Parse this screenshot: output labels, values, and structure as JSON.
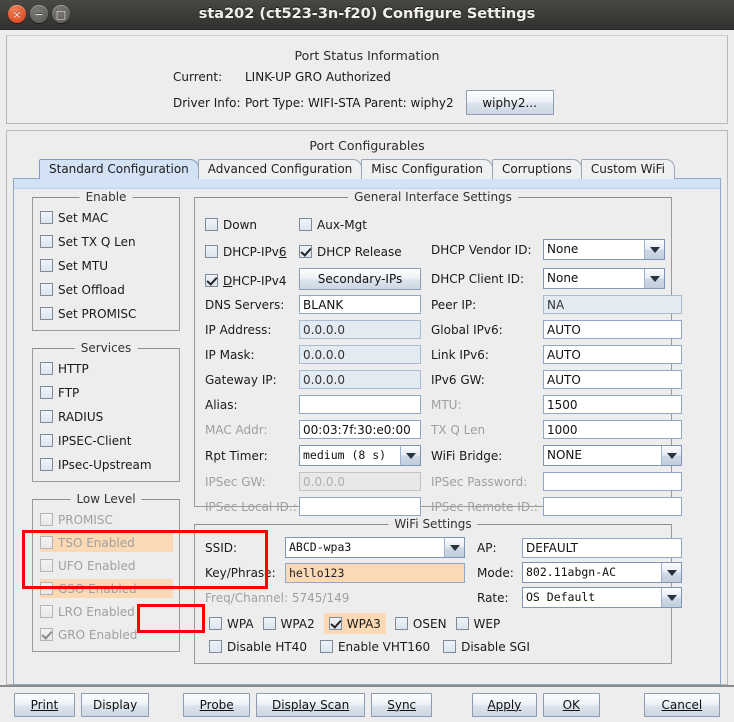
{
  "window": {
    "title": "sta202  (ct523-3n-f20) Configure Settings",
    "controls": [
      {
        "name": "close",
        "glyph": "×"
      },
      {
        "name": "minimize",
        "glyph": "−"
      },
      {
        "name": "maximize",
        "glyph": "□"
      }
    ]
  },
  "port_status": {
    "title": "Port Status Information",
    "current_label": "Current:",
    "current_value": "LINK-UP GRO  Authorized",
    "driver_label": "Driver Info:",
    "driver_value": "Port Type: WIFI-STA   Parent: wiphy2",
    "wiphy_button": "wiphy2..."
  },
  "configurables": {
    "title": "Port Configurables",
    "tabs": [
      {
        "label": "Standard Configuration",
        "active": true
      },
      {
        "label": "Advanced Configuration",
        "active": false
      },
      {
        "label": "Misc Configuration",
        "active": false
      },
      {
        "label": "Corruptions",
        "active": false
      },
      {
        "label": "Custom WiFi",
        "active": false
      }
    ]
  },
  "enable_group": {
    "legend": "Enable",
    "items": [
      {
        "label": "Set MAC",
        "checked": false
      },
      {
        "label": "Set TX Q Len",
        "checked": false
      },
      {
        "label": "Set MTU",
        "checked": false
      },
      {
        "label": "Set Offload",
        "checked": false
      },
      {
        "label": "Set PROMISC",
        "checked": false
      }
    ]
  },
  "services_group": {
    "legend": "Services",
    "items": [
      {
        "label": "HTTP",
        "checked": false
      },
      {
        "label": "FTP",
        "checked": false
      },
      {
        "label": "RADIUS",
        "checked": false
      },
      {
        "label": "IPSEC-Client",
        "checked": false
      },
      {
        "label": "IPsec-Upstream",
        "checked": false
      }
    ]
  },
  "lowlevel_group": {
    "legend": "Low Level",
    "items": [
      {
        "label": "PROMISC",
        "checked": false,
        "highlight": false
      },
      {
        "label": "TSO Enabled",
        "checked": false,
        "highlight": true
      },
      {
        "label": "UFO Enabled",
        "checked": false,
        "highlight": false
      },
      {
        "label": "GSO Enabled",
        "checked": false,
        "highlight": true
      },
      {
        "label": "LRO Enabled",
        "checked": false,
        "highlight": false
      },
      {
        "label": "GRO Enabled",
        "checked": true,
        "highlight": false
      }
    ]
  },
  "general": {
    "legend": "General Interface Settings",
    "down_label": "Down",
    "aux_mgt_label": "Aux-Mgt",
    "dhcp_ipv6_label": "DHCP-IPv6",
    "dhcp_release_label": "DHCP Release",
    "dhcp_ipv4_label": "DHCP-IPv4",
    "secondary_ips_button": "Secondary-IPs",
    "dhcp_vendor_label": "DHCP Vendor ID:",
    "dhcp_vendor_value": "None",
    "dhcp_client_label": "DHCP Client ID:",
    "dhcp_client_value": "None",
    "dns_label": "DNS Servers:",
    "dns_value": "BLANK",
    "peer_ip_label": "Peer IP:",
    "peer_ip_value": "NA",
    "ip_address_label": "IP Address:",
    "ip_address_value": "0.0.0.0",
    "global_ipv6_label": "Global IPv6:",
    "global_ipv6_value": "AUTO",
    "ip_mask_label": "IP Mask:",
    "ip_mask_value": "0.0.0.0",
    "link_ipv6_label": "Link IPv6:",
    "link_ipv6_value": "AUTO",
    "gateway_label": "Gateway IP:",
    "gateway_value": "0.0.0.0",
    "ipv6_gw_label": "IPv6 GW:",
    "ipv6_gw_value": "AUTO",
    "alias_label": "Alias:",
    "alias_value": "",
    "mtu_label": "MTU:",
    "mtu_value": "1500",
    "mac_addr_label": "MAC Addr:",
    "mac_addr_value": "00:03:7f:30:e0:00",
    "tx_q_len_label": "TX Q Len",
    "tx_q_len_value": "1000",
    "rpt_timer_label": "Rpt Timer:",
    "rpt_timer_value": "medium  (8 s)",
    "wifi_bridge_label": "WiFi Bridge:",
    "wifi_bridge_value": "NONE",
    "ipsec_gw_label": "IPSec GW:",
    "ipsec_gw_value": "0.0.0.0",
    "ipsec_password_label": "IPSec Password:",
    "ipsec_password_value": "",
    "ipsec_local_id_label": "IPSec Local ID.:",
    "ipsec_local_id_value": "",
    "ipsec_remote_id_label": "IPSec Remote ID.:",
    "ipsec_remote_id_value": "",
    "checks": {
      "down": false,
      "aux_mgt": false,
      "dhcp_ipv6": false,
      "dhcp_release": true,
      "dhcp_ipv4": true
    }
  },
  "wifi": {
    "legend": "WiFi Settings",
    "ssid_label": "SSID:",
    "ssid_value": "ABCD-wpa3",
    "ap_label": "AP:",
    "ap_value": "DEFAULT",
    "key_label": "Key/Phrase:",
    "key_value": "hello123",
    "mode_label": "Mode:",
    "mode_value": "802.11abgn-AC",
    "freq_channel_label": "Freq/Channel: 5745/149",
    "rate_label": "Rate:",
    "rate_value": "OS Default",
    "security": [
      {
        "label": "WPA",
        "checked": false,
        "highlight": false
      },
      {
        "label": "WPA2",
        "checked": false,
        "highlight": false
      },
      {
        "label": "WPA3",
        "checked": true,
        "highlight": true
      },
      {
        "label": "OSEN",
        "checked": false,
        "highlight": false
      },
      {
        "label": "WEP",
        "checked": false,
        "highlight": false
      }
    ],
    "options": [
      {
        "label": "Disable HT40",
        "checked": false
      },
      {
        "label": "Enable VHT160",
        "checked": false
      },
      {
        "label": "Disable SGI",
        "checked": false
      }
    ]
  },
  "footer": {
    "buttons": [
      {
        "label": "Print",
        "mnemonic": 0
      },
      {
        "label": "Display",
        "mnemonic": -1
      },
      {
        "label": "Probe",
        "mnemonic": 0
      },
      {
        "label": "Display Scan",
        "mnemonic": 11
      },
      {
        "label": "Sync",
        "mnemonic": 0
      },
      {
        "label": "Apply",
        "mnemonic": 0
      },
      {
        "label": "OK",
        "mnemonic": 0
      },
      {
        "label": "Cancel",
        "mnemonic": 0
      }
    ]
  },
  "annotations": {
    "accent_color": "#ff0000",
    "highlight_color": "#fbd9b4"
  }
}
